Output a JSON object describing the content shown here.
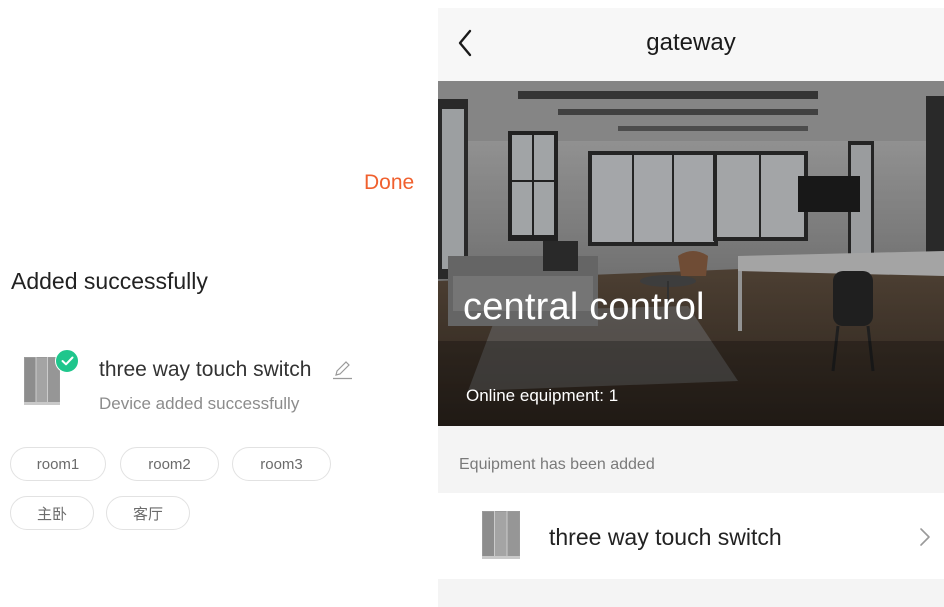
{
  "left": {
    "done_label": "Done",
    "title": "Added successfully",
    "device": {
      "name": "three way touch switch",
      "status": "Device added successfully",
      "icon": "switch-panel-icon"
    },
    "rooms": [
      "room1",
      "room2",
      "room3",
      "主卧",
      "客厅"
    ]
  },
  "right": {
    "nav_title": "gateway",
    "hero": {
      "title": "central control",
      "online_label": "Online equipment: 1"
    },
    "section_label": "Equipment has been added",
    "equipment": [
      {
        "name": "three way touch switch",
        "icon": "switch-panel-icon"
      }
    ]
  },
  "colors": {
    "accent": "#f0602e",
    "success": "#1fc68c",
    "panel_bg": "#f4f4f4"
  }
}
